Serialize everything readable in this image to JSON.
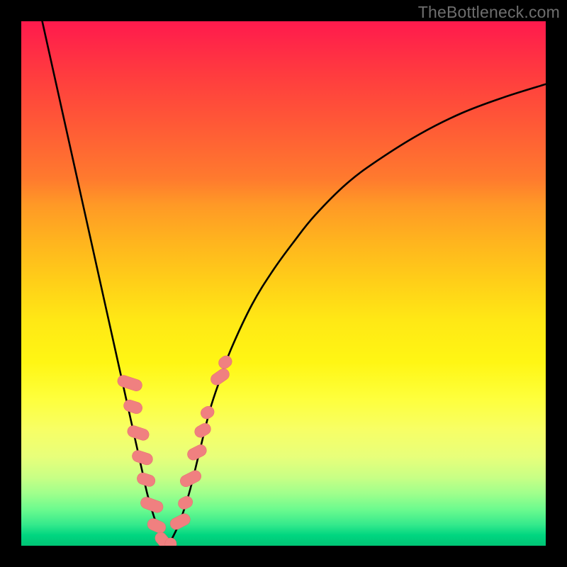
{
  "watermark": "TheBottleneck.com",
  "colors": {
    "curve": "#000000",
    "marker_fill": "#f08080",
    "marker_stroke": "#e46f6f"
  },
  "chart_data": {
    "type": "line",
    "title": "",
    "xlabel": "",
    "ylabel": "",
    "xlim": [
      0,
      100
    ],
    "ylim": [
      0,
      100
    ],
    "grid": false,
    "legend": false,
    "series": [
      {
        "name": "left-branch",
        "x": [
          4,
          6,
          8,
          10,
          12,
          14,
          16,
          18,
          20,
          21,
          22,
          23,
          24,
          25,
          26,
          27,
          28
        ],
        "y": [
          100,
          91,
          82,
          73,
          64,
          55,
          46,
          37,
          28,
          23.5,
          19,
          14.5,
          10,
          6.5,
          3.5,
          1.2,
          0
        ]
      },
      {
        "name": "right-branch",
        "x": [
          28,
          30,
          32,
          34,
          36,
          38,
          40,
          44,
          48,
          52,
          56,
          62,
          68,
          76,
          84,
          92,
          100
        ],
        "y": [
          0,
          4,
          10,
          18,
          26,
          32,
          37.5,
          46,
          52.5,
          58,
          63,
          69,
          73.5,
          78.5,
          82.5,
          85.5,
          88
        ]
      }
    ],
    "markers": {
      "name": "scatter-points",
      "shape": "pill",
      "points": [
        {
          "x": 20.7,
          "y": 31,
          "angle": -72,
          "w": 2.2,
          "h": 4.8
        },
        {
          "x": 21.3,
          "y": 26.5,
          "angle": -72,
          "w": 2.2,
          "h": 3.6
        },
        {
          "x": 22.3,
          "y": 21.5,
          "angle": -72,
          "w": 2.2,
          "h": 4.2
        },
        {
          "x": 23.1,
          "y": 16.8,
          "angle": -72,
          "w": 2.2,
          "h": 4.0
        },
        {
          "x": 23.8,
          "y": 12.6,
          "angle": -72,
          "w": 2.2,
          "h": 3.5
        },
        {
          "x": 24.9,
          "y": 7.8,
          "angle": -70,
          "w": 2.2,
          "h": 4.4
        },
        {
          "x": 25.8,
          "y": 3.8,
          "angle": -66,
          "w": 2.2,
          "h": 3.6
        },
        {
          "x": 27.0,
          "y": 1.0,
          "angle": -40,
          "w": 2.2,
          "h": 3.4
        },
        {
          "x": 28.5,
          "y": 0.3,
          "angle": 0,
          "w": 2.2,
          "h": 2.4
        },
        {
          "x": 30.3,
          "y": 4.6,
          "angle": 63,
          "w": 2.2,
          "h": 4.0
        },
        {
          "x": 31.3,
          "y": 8.2,
          "angle": 63,
          "w": 2.2,
          "h": 2.8
        },
        {
          "x": 32.3,
          "y": 12.8,
          "angle": 63,
          "w": 2.2,
          "h": 4.2
        },
        {
          "x": 33.5,
          "y": 17.8,
          "angle": 63,
          "w": 2.2,
          "h": 3.8
        },
        {
          "x": 34.6,
          "y": 22.0,
          "angle": 60,
          "w": 2.2,
          "h": 3.2
        },
        {
          "x": 35.5,
          "y": 25.4,
          "angle": 58,
          "w": 2.2,
          "h": 2.6
        },
        {
          "x": 37.9,
          "y": 32.2,
          "angle": 55,
          "w": 2.2,
          "h": 3.8
        },
        {
          "x": 38.9,
          "y": 35.0,
          "angle": 53,
          "w": 2.2,
          "h": 2.6
        }
      ]
    }
  }
}
